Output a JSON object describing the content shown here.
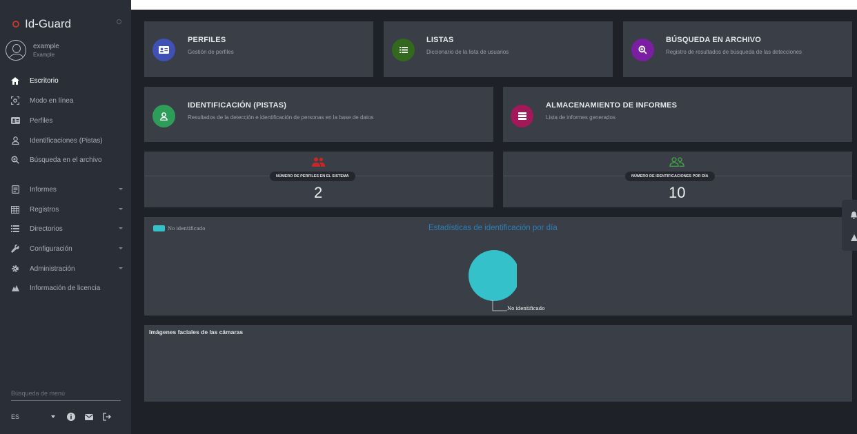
{
  "app": {
    "name": "Id-Guard"
  },
  "user": {
    "name": "example",
    "role": "Example"
  },
  "sidebar": {
    "items": [
      {
        "label": "Escritorio",
        "icon": "home-icon",
        "active": true,
        "expandable": false
      },
      {
        "label": "Modo en línea",
        "icon": "scan-face-icon",
        "active": false,
        "expandable": false
      },
      {
        "label": "Perfiles",
        "icon": "id-card-icon",
        "active": false,
        "expandable": false
      },
      {
        "label": "Identificaciones (Pistas)",
        "icon": "user-icon",
        "active": false,
        "expandable": false
      },
      {
        "label": "Búsqueda en el archivo",
        "icon": "search-plus-icon",
        "active": false,
        "expandable": false
      },
      {
        "label": "Informes",
        "icon": "report-icon",
        "active": false,
        "expandable": true
      },
      {
        "label": "Registros",
        "icon": "table-icon",
        "active": false,
        "expandable": true
      },
      {
        "label": "Directorios",
        "icon": "list-icon",
        "active": false,
        "expandable": true
      },
      {
        "label": "Configuración",
        "icon": "wrench-icon",
        "active": false,
        "expandable": true
      },
      {
        "label": "Administración",
        "icon": "gear-icon",
        "active": false,
        "expandable": true
      },
      {
        "label": "Información de licencia",
        "icon": "license-icon",
        "active": false,
        "expandable": false
      }
    ],
    "search_placeholder": "Búsqueda de menú",
    "language": "ES",
    "bottom_icons": [
      "info-icon",
      "mail-icon",
      "logout-icon"
    ]
  },
  "cards": {
    "perfiles": {
      "title": "PERFILES",
      "subtitle": "Gestión de perfiles",
      "icon": "id-card-icon",
      "color": "#3f51b5"
    },
    "listas": {
      "title": "LISTAS",
      "subtitle": "Diccionario de la lista de usuarios",
      "icon": "list-icon",
      "color": "#33691e"
    },
    "busqueda": {
      "title": "BÚSQUEDA EN ARCHIVO",
      "subtitle": "Registro de resultados de búsqueda de las detecciones",
      "icon": "search-plus-icon",
      "color": "#7b1fa2"
    },
    "identificacion": {
      "title": "IDENTIFICACIÓN (PISTAS)",
      "subtitle": "Resultados de la detección e identificación de personas en la base de datos",
      "icon": "user-icon",
      "color": "#2e9d5a"
    },
    "almacenamiento": {
      "title": "ALMACENAMIENTO DE INFORMES",
      "subtitle": "Lista de informes generados",
      "icon": "storage-icon",
      "color": "#a1195a"
    }
  },
  "stats": {
    "profiles": {
      "label": "NÚMERO DE PERFILES EN EL SISTEMA",
      "value": "2",
      "icon": "users-icon",
      "color": "#c62828"
    },
    "identifications": {
      "label": "NÚMERO DE IDENTIFICACIONES POR DÍA",
      "value": "10",
      "icon": "users-outline-icon",
      "color": "#43a047"
    }
  },
  "chart_data": {
    "type": "pie",
    "title": "Estadísticas de identificación por día",
    "legend_position": "top-left",
    "series": [
      {
        "name": "No identificado",
        "values": [
          100
        ]
      }
    ],
    "categories": [
      "No identificado"
    ],
    "colors": [
      "#35c1c9"
    ]
  },
  "faces_panel": {
    "title": "Imágenes faciales de las cámaras"
  },
  "right_tab_icons": [
    "bell-icon",
    "warning-icon"
  ]
}
